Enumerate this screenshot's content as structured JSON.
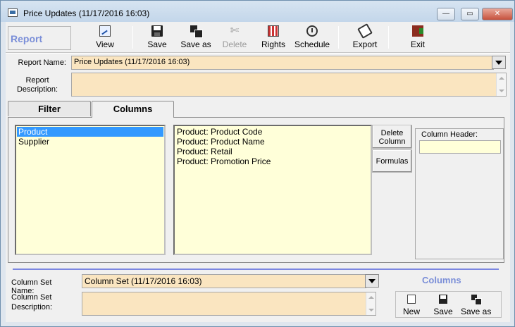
{
  "window": {
    "title": "Price Updates (11/17/2016 16:03)",
    "controls": {
      "minimize": "—",
      "maximize": "▭",
      "close": "✕"
    }
  },
  "toolbar": {
    "section_label": "Report",
    "buttons": [
      {
        "label": "View",
        "icon": "view-icon"
      },
      {
        "label": "Save",
        "icon": "save-icon"
      },
      {
        "label": "Save as",
        "icon": "save-as-icon"
      },
      {
        "label": "Delete",
        "icon": "delete-icon",
        "disabled": true
      },
      {
        "label": "Rights",
        "icon": "rights-icon"
      },
      {
        "label": "Schedule",
        "icon": "schedule-icon"
      },
      {
        "label": "Export",
        "icon": "export-icon"
      },
      {
        "label": "Exit",
        "icon": "exit-icon"
      }
    ],
    "delete_glyph": "✄"
  },
  "report": {
    "name_label": "Report Name:",
    "name_value": "Price Updates (11/17/2016 16:03)",
    "description_label_line1": "Report",
    "description_label_line2": "Description:",
    "description_value": ""
  },
  "tabs": [
    {
      "label": "Filter",
      "active": false
    },
    {
      "label": "Columns",
      "active": true
    }
  ],
  "columns_tab": {
    "source_list": [
      {
        "label": "Product",
        "selected": true
      },
      {
        "label": "Supplier",
        "selected": false
      }
    ],
    "selected_columns": [
      "Product: Product Code",
      "Product: Product Name",
      "Product: Retail",
      "Product: Promotion Price"
    ],
    "delete_column_line1": "Delete",
    "delete_column_line2": "Column",
    "formulas_label": "Formulas",
    "column_header_label": "Column Header:",
    "column_header_value": ""
  },
  "column_set": {
    "section_label": "Columns",
    "name_label": "Column Set Name:",
    "name_value": "Column Set (11/17/2016 16:03)",
    "description_label_line1": "Column Set",
    "description_label_line2": "Description:",
    "description_value": "",
    "buttons": [
      {
        "label": "New",
        "icon": "new-icon"
      },
      {
        "label": "Save",
        "icon": "save-icon"
      },
      {
        "label": "Save as",
        "icon": "save-as-icon"
      }
    ]
  },
  "colors": {
    "field_bg": "#fae5c0",
    "list_bg": "#ffffd9",
    "selection": "#3399ff",
    "accent_label": "#7a8ed8",
    "divider_line": "#7b86e0"
  }
}
